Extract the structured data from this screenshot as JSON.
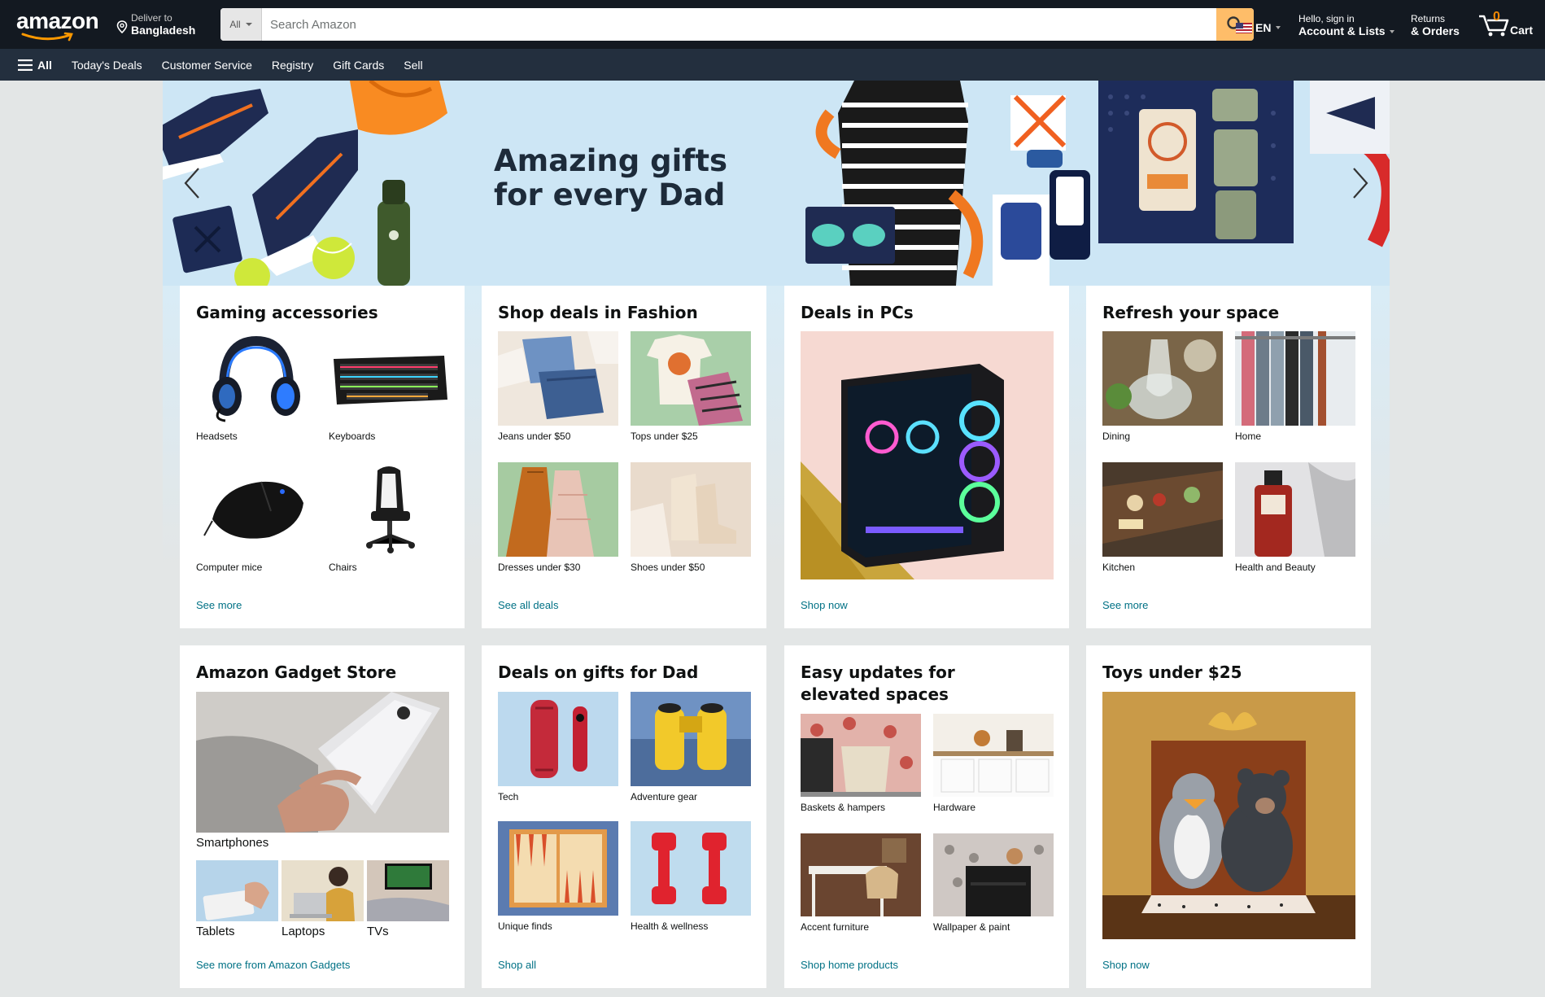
{
  "header": {
    "logo_text": "amazon",
    "deliver_line1": "Deliver to",
    "deliver_line2": "Bangladesh",
    "search_category": "All",
    "search_placeholder": "Search Amazon",
    "language": "EN",
    "account_line1": "Hello, sign in",
    "account_line2": "Account & Lists",
    "returns_line1": "Returns",
    "returns_line2": "& Orders",
    "cart_count": "0",
    "cart_label": "Cart",
    "accent_color": "#febd69",
    "cart_count_color": "#f08804"
  },
  "subnav": {
    "all_label": "All",
    "items": [
      "Today's Deals",
      "Customer Service",
      "Registry",
      "Gift Cards",
      "Sell"
    ]
  },
  "hero": {
    "title_line1": "Amazing gifts",
    "title_line2": "for every Dad"
  },
  "cards": [
    {
      "title": "Gaming accessories",
      "items": [
        "Headsets",
        "Keyboards",
        "Computer mice",
        "Chairs"
      ],
      "link": "See more"
    },
    {
      "title": "Shop deals in Fashion",
      "items": [
        "Jeans under $50",
        "Tops under $25",
        "Dresses under $30",
        "Shoes under $50"
      ],
      "link": "See all deals"
    },
    {
      "title": "Deals in PCs",
      "link": "Shop now"
    },
    {
      "title": "Refresh your space",
      "items": [
        "Dining",
        "Home",
        "Kitchen",
        "Health and Beauty"
      ],
      "link": "See more"
    },
    {
      "title": "Amazon Gadget Store",
      "main_item": "Smartphones",
      "items": [
        "Tablets",
        "Laptops",
        "TVs"
      ],
      "link": "See more from Amazon Gadgets"
    },
    {
      "title": "Deals on gifts for Dad",
      "items": [
        "Tech",
        "Adventure gear",
        "Unique finds",
        "Health & wellness"
      ],
      "link": "Shop all"
    },
    {
      "title": "Easy updates for elevated spaces",
      "items": [
        "Baskets & hampers",
        "Hardware",
        "Accent furniture",
        "Wallpaper & paint"
      ],
      "link": "Shop home products"
    },
    {
      "title": "Toys under $25",
      "link": "Shop now"
    }
  ]
}
